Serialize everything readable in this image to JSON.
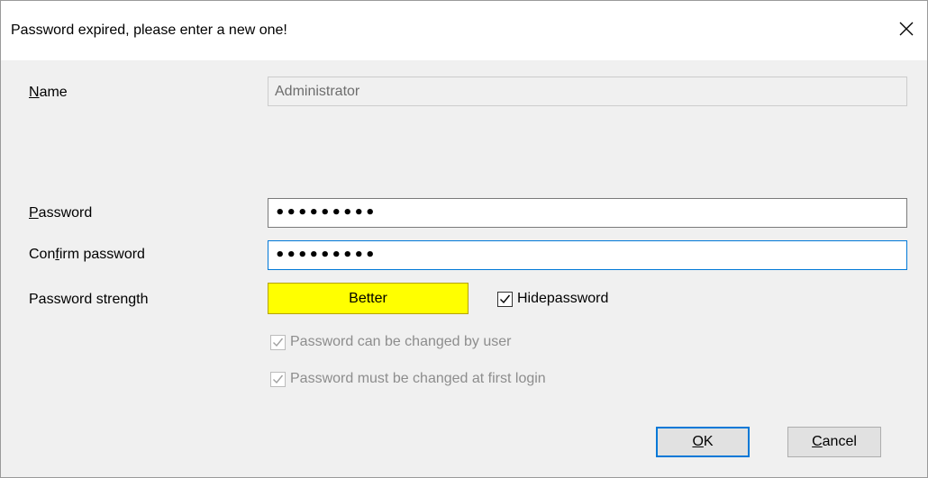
{
  "dialog": {
    "title": "Password expired, please enter a new one!"
  },
  "form": {
    "name_label_prefix": "",
    "name_label_mnemonic": "N",
    "name_label_rest": "ame",
    "name_value": "Administrator",
    "password_label_mnemonic": "P",
    "password_label_rest": "assword",
    "password_value": "•••••••••",
    "confirm_label_pre": "Con",
    "confirm_label_mnemonic": "f",
    "confirm_label_rest": "irm password",
    "confirm_value": "•••••••••",
    "strength_label": "Password strength",
    "strength_value": "Better",
    "strength_color": "#ffff00"
  },
  "options": {
    "hide_password_label": "Hidepassword",
    "hide_password_checked": true,
    "can_change_label": "Password can be changed by user",
    "can_change_checked": true,
    "must_change_label": "Password must be changed at first login",
    "must_change_checked": true
  },
  "buttons": {
    "ok_mnemonic": "O",
    "ok_rest": "K",
    "cancel_mnemonic": "C",
    "cancel_rest": "ancel"
  },
  "icons": {
    "close": "close-icon",
    "checkmark": "checkmark-icon"
  }
}
